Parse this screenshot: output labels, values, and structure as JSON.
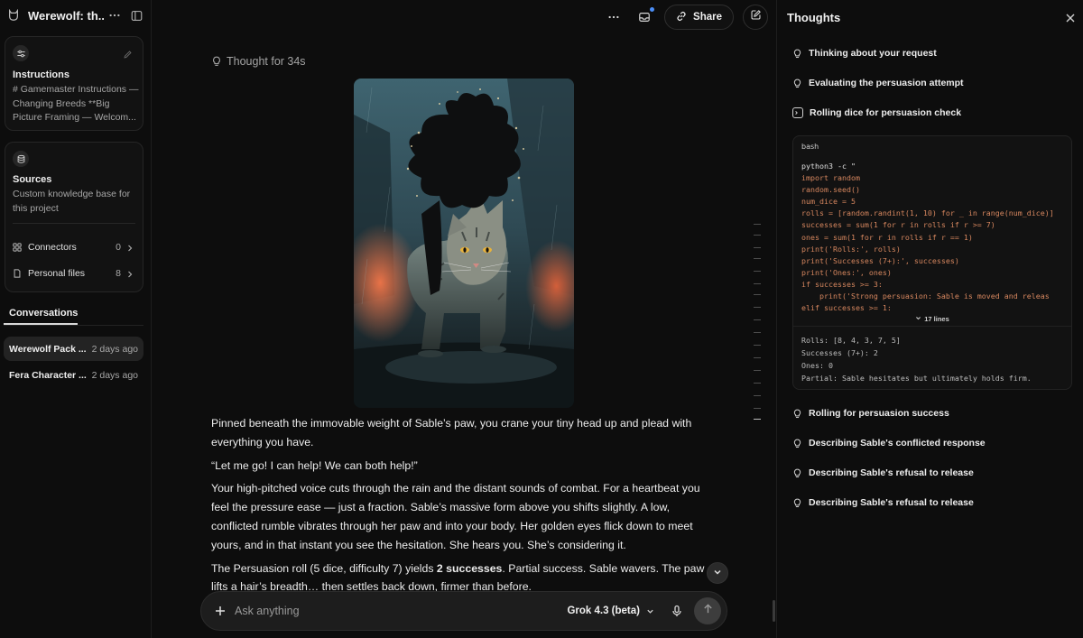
{
  "project": {
    "title": "Werewolf: th..."
  },
  "instructions": {
    "title": "Instructions",
    "text": "# Gamemaster Instructions — Changing Breeds **Big Picture Framing — Welcom..."
  },
  "sources": {
    "title": "Sources",
    "description": "Custom knowledge base for this project",
    "rows": [
      {
        "label": "Connectors",
        "count": "0"
      },
      {
        "label": "Personal files",
        "count": "8"
      }
    ]
  },
  "conversations": {
    "tab": "Conversations",
    "items": [
      {
        "title": "Werewolf Pack ...",
        "date": "2 days ago",
        "active": true
      },
      {
        "title": "Fera Character ...",
        "date": "2 days ago",
        "active": false
      }
    ]
  },
  "topbar": {
    "share_label": "Share"
  },
  "thought_summary": "Thought for 34s",
  "message": {
    "p1": "Pinned beneath the immovable weight of Sable’s paw, you crane your tiny head up and plead with everything you have.",
    "p2": "“Let me go! I can help! We can both help!”",
    "p3": "Your high-pitched voice cuts through the rain and the distant sounds of combat. For a heartbeat you feel the pressure ease — just a fraction. Sable’s massive form above you shifts slightly. A low, conflicted rumble vibrates through her paw and into your body. Her golden eyes flick down to meet yours, and in that instant you see the hesitation. She hears you. She’s considering it.",
    "p4_pre": "The Persuasion roll (5 dice, difficulty 7) yields ",
    "p4_bold": "2 successes",
    "p4_post": ". Partial success. Sable wavers. The paw lifts a hair’s breadth… then settles back down, firmer than before."
  },
  "composer": {
    "placeholder": "Ask anything",
    "model": "Grok 4.3 (beta)"
  },
  "thoughts": {
    "title": "Thoughts",
    "steps_before": [
      {
        "label": "Thinking about your request",
        "icon": "lightbulb-icon"
      },
      {
        "label": "Evaluating the persuasion attempt",
        "icon": "lightbulb-icon"
      },
      {
        "label": "Rolling dice for persuasion check",
        "icon": "terminal-icon"
      }
    ],
    "code": {
      "language": "bash",
      "lines": [
        "python3 -c \"",
        "import random",
        "random.seed()",
        "num_dice = 5",
        "rolls = [random.randint(1, 10) for _ in range(num_dice)]",
        "successes = sum(1 for r in rolls if r >= 7)",
        "ones = sum(1 for r in rolls if r == 1)",
        "print('Rolls:', rolls)",
        "print('Successes (7+):', successes)",
        "print('Ones:', ones)",
        "if successes >= 3:",
        "    print('Strong persuasion: Sable is moved and releas",
        "elif successes >= 1:"
      ],
      "more_label": "17 lines",
      "output": [
        "Rolls: [8, 4, 3, 7, 5]",
        "Successes (7+): 2",
        "Ones: 0",
        "Partial: Sable hesitates but ultimately holds firm."
      ]
    },
    "steps_after": [
      {
        "label": "Rolling for persuasion success",
        "icon": "lightbulb-icon"
      },
      {
        "label": "Describing Sable's conflicted response",
        "icon": "lightbulb-icon"
      },
      {
        "label": "Describing Sable's refusal to release",
        "icon": "lightbulb-icon"
      },
      {
        "label": "Describing Sable's refusal to release",
        "icon": "lightbulb-icon"
      }
    ]
  }
}
